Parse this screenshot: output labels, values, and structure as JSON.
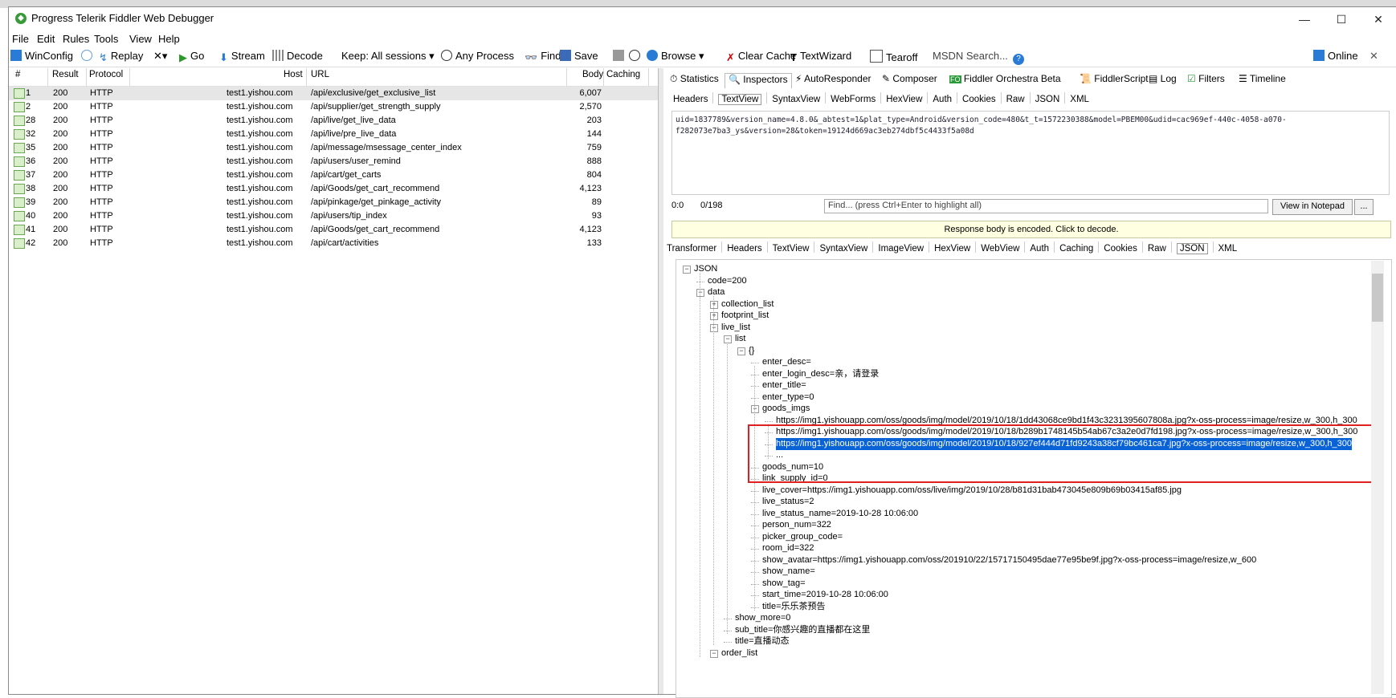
{
  "window": {
    "title": "Progress Telerik Fiddler Web Debugger"
  },
  "menu": [
    "File",
    "Edit",
    "Rules",
    "Tools",
    "View",
    "Help"
  ],
  "toolbar": {
    "winconfig": "WinConfig",
    "replay": "Replay",
    "go": "Go",
    "stream": "Stream",
    "decode": "Decode",
    "keep": "Keep: All sessions",
    "any_process": "Any Process",
    "find": "Find",
    "save": "Save",
    "browse": "Browse",
    "clear_cache": "Clear Cache",
    "textwizard": "TextWizard",
    "tearoff": "Tearoff",
    "msdn_search": "MSDN Search...",
    "online": "Online"
  },
  "sessions": {
    "columns": [
      "#",
      "Result",
      "Protocol",
      "Host",
      "URL",
      "Body",
      "Caching"
    ],
    "rows": [
      {
        "id": "1",
        "result": "200",
        "protocol": "HTTP",
        "host": "test1.yishou.com",
        "url": "/api/exclusive/get_exclusive_list",
        "body": "6,007"
      },
      {
        "id": "2",
        "result": "200",
        "protocol": "HTTP",
        "host": "test1.yishou.com",
        "url": "/api/supplier/get_strength_supply",
        "body": "2,570"
      },
      {
        "id": "28",
        "result": "200",
        "protocol": "HTTP",
        "host": "test1.yishou.com",
        "url": "/api/live/get_live_data",
        "body": "203"
      },
      {
        "id": "32",
        "result": "200",
        "protocol": "HTTP",
        "host": "test1.yishou.com",
        "url": "/api/live/pre_live_data",
        "body": "144"
      },
      {
        "id": "35",
        "result": "200",
        "protocol": "HTTP",
        "host": "test1.yishou.com",
        "url": "/api/message/msessage_center_index",
        "body": "759"
      },
      {
        "id": "36",
        "result": "200",
        "protocol": "HTTP",
        "host": "test1.yishou.com",
        "url": "/api/users/user_remind",
        "body": "888"
      },
      {
        "id": "37",
        "result": "200",
        "protocol": "HTTP",
        "host": "test1.yishou.com",
        "url": "/api/cart/get_carts",
        "body": "804"
      },
      {
        "id": "38",
        "result": "200",
        "protocol": "HTTP",
        "host": "test1.yishou.com",
        "url": "/api/Goods/get_cart_recommend",
        "body": "4,123"
      },
      {
        "id": "39",
        "result": "200",
        "protocol": "HTTP",
        "host": "test1.yishou.com",
        "url": "/api/pinkage/get_pinkage_activity",
        "body": "89"
      },
      {
        "id": "40",
        "result": "200",
        "protocol": "HTTP",
        "host": "test1.yishou.com",
        "url": "/api/users/tip_index",
        "body": "93"
      },
      {
        "id": "41",
        "result": "200",
        "protocol": "HTTP",
        "host": "test1.yishou.com",
        "url": "/api/Goods/get_cart_recommend",
        "body": "4,123"
      },
      {
        "id": "42",
        "result": "200",
        "protocol": "HTTP",
        "host": "test1.yishou.com",
        "url": "/api/cart/activities",
        "body": "133"
      }
    ]
  },
  "inspector_tabs": [
    "Statistics",
    "Inspectors",
    "AutoResponder",
    "Composer",
    "Fiddler Orchestra Beta",
    "FiddlerScript",
    "Log",
    "Filters",
    "Timeline"
  ],
  "request_tabs": [
    "Headers",
    "TextView",
    "SyntaxView",
    "WebForms",
    "HexView",
    "Auth",
    "Cookies",
    "Raw",
    "JSON",
    "XML"
  ],
  "request_text": "uid=1837789&version_name=4.8.0&_abtest=1&plat_type=Android&version_code=480&t_t=1572230388&model=PBEM00&udid=cac969ef-440c-4058-a070-f282073e7ba3_ys&version=28&token=19124d669ac3eb274dbf5c4433f5a08d",
  "find": {
    "pos": "0:0",
    "count": "0/198",
    "placeholder": "Find... (press Ctrl+Enter to highlight all)",
    "notepad": "View in Notepad",
    "more": "..."
  },
  "encoded_notice": "Response body is encoded. Click to decode.",
  "response_tabs": [
    "Transformer",
    "Headers",
    "TextView",
    "SyntaxView",
    "ImageView",
    "HexView",
    "WebView",
    "Auth",
    "Caching",
    "Cookies",
    "Raw",
    "JSON",
    "XML"
  ],
  "tree": [
    "JSON",
    "code=200",
    "data",
    "collection_list",
    "footprint_list",
    "live_list",
    "list",
    "{}",
    "enter_desc=",
    "enter_login_desc=亲，请登录",
    "enter_title=",
    "enter_type=0",
    "goods_imgs",
    "https://img1.yishouapp.com/oss/goods/img/model/2019/10/18/1dd43068ce9bd1f43c3231395607808a.jpg?x-oss-process=image/resize,w_300,h_300",
    "https://img1.yishouapp.com/oss/goods/img/model/2019/10/18/b289b1748145b54ab67c3a2e0d7fd198.jpg?x-oss-process=image/resize,w_300,h_300",
    "https://img1.yishouapp.com/oss/goods/img/model/2019/10/18/927ef444d71fd9243a38cf79bc461ca7.jpg?x-oss-process=image/resize,w_300,h_300",
    "...",
    "goods_num=10",
    "link_supply_id=0",
    "live_cover=https://img1.yishouapp.com/oss/live/img/2019/10/28/b81d31bab473045e809b69b03415af85.jpg",
    "live_status=2",
    "live_status_name=2019-10-28 10:06:00",
    "person_num=322",
    "picker_group_code=",
    "room_id=322",
    "show_avatar=https://img1.yishouapp.com/oss/201910/22/15717150495dae77e95be9f.jpg?x-oss-process=image/resize,w_600",
    "show_name=",
    "show_tag=",
    "start_time=2019-10-28 10:06:00",
    "title=乐乐茶预告",
    "show_more=0",
    "sub_title=你感兴趣的直播都在这里",
    "title=直播动态",
    "order_list"
  ]
}
